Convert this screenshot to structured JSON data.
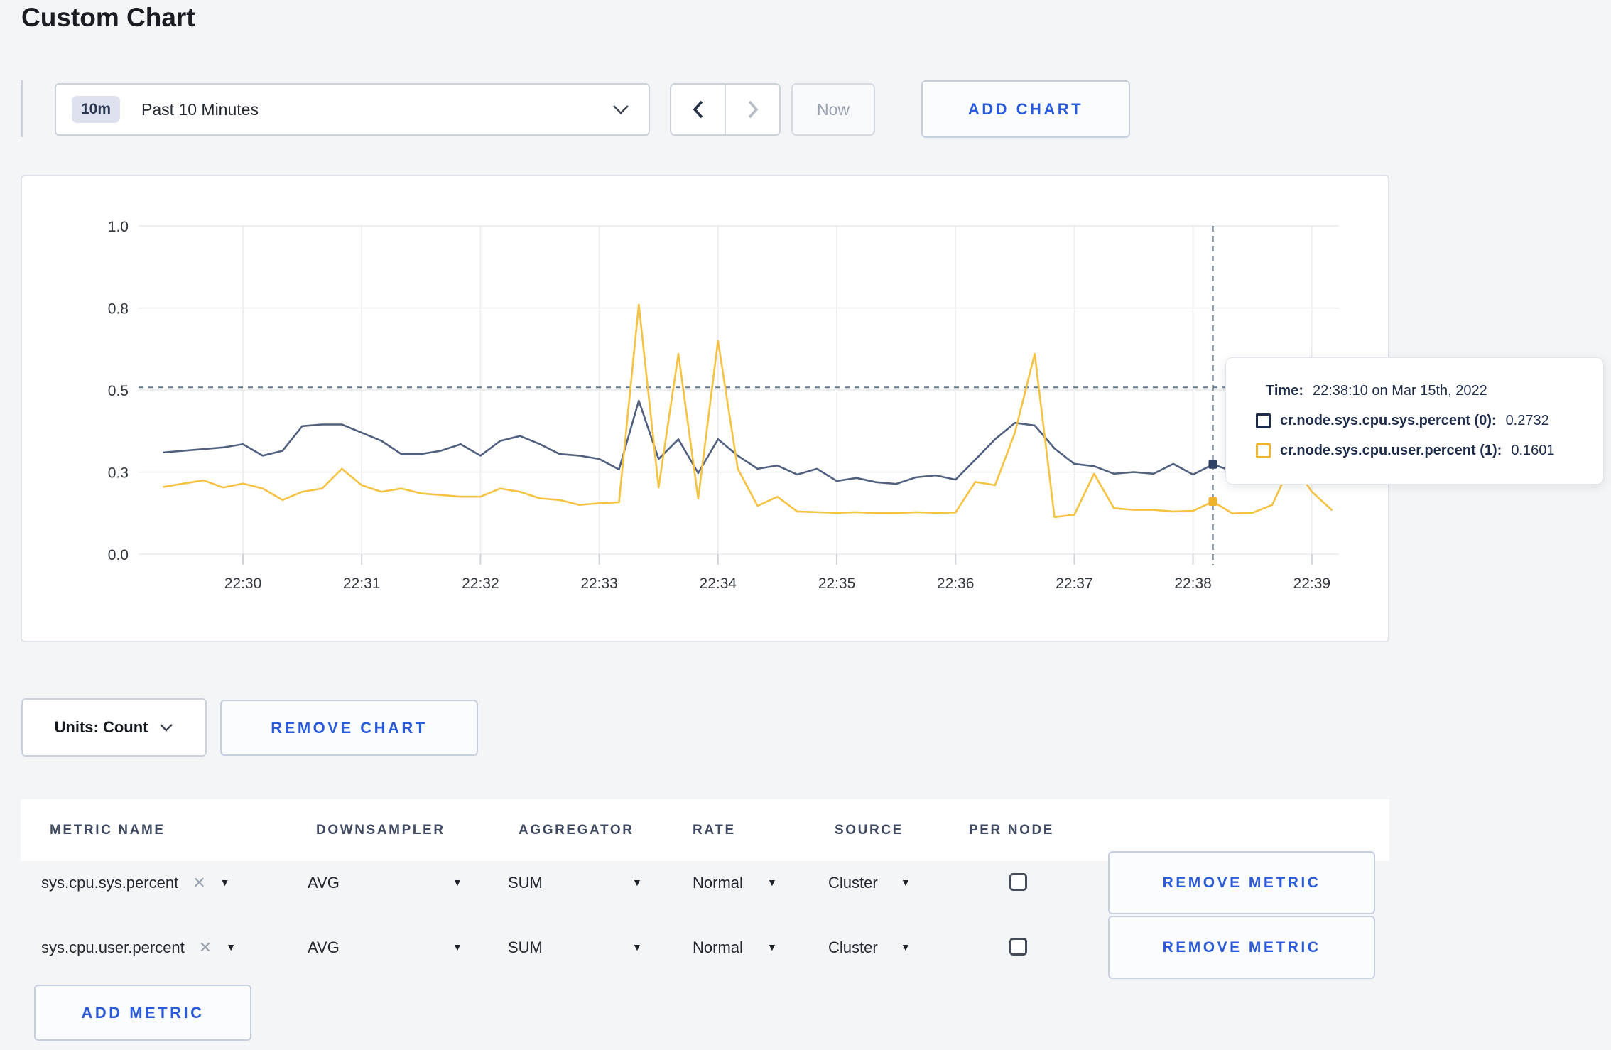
{
  "page": {
    "title": "Custom Chart"
  },
  "toolbar": {
    "time_badge": "10m",
    "time_label": "Past 10 Minutes",
    "now_label": "Now",
    "add_chart_label": "ADD CHART"
  },
  "chart_footer": {
    "units_label": "Units: Count",
    "remove_chart_label": "REMOVE CHART"
  },
  "tooltip": {
    "time_label": "Time:",
    "time_value": "22:38:10 on Mar 15th, 2022",
    "rows": [
      {
        "name": "cr.node.sys.cpu.sys.percent (0):",
        "value": "0.2732",
        "color": "#1c2b4a"
      },
      {
        "name": "cr.node.sys.cpu.user.percent (1):",
        "value": "0.1601",
        "color": "#f0b429"
      }
    ]
  },
  "metrics_table": {
    "headers": [
      "METRIC NAME",
      "DOWNSAMPLER",
      "AGGREGATOR",
      "RATE",
      "SOURCE",
      "PER NODE"
    ],
    "rows": [
      {
        "metric": "sys.cpu.sys.percent",
        "downsampler": "AVG",
        "aggregator": "SUM",
        "rate": "Normal",
        "source": "Cluster",
        "per_node_checked": false,
        "remove_label": "REMOVE METRIC"
      },
      {
        "metric": "sys.cpu.user.percent",
        "downsampler": "AVG",
        "aggregator": "SUM",
        "rate": "Normal",
        "source": "Cluster",
        "per_node_checked": false,
        "remove_label": "REMOVE METRIC"
      }
    ],
    "add_metric_label": "ADD METRIC"
  },
  "chart_data": {
    "type": "line",
    "title": "",
    "xlabel": "",
    "ylabel": "",
    "ylim": [
      0,
      1
    ],
    "grid": true,
    "legend_position": "tooltip",
    "y_ticks": [
      {
        "v": 0,
        "label": "0.0"
      },
      {
        "v": 0.25,
        "label": "0.3"
      },
      {
        "v": 0.5,
        "label": "0.5"
      },
      {
        "v": 0.75,
        "label": "0.8"
      },
      {
        "v": 1,
        "label": "1.0"
      }
    ],
    "x_ticks": [
      {
        "t": 60,
        "label": "22:30"
      },
      {
        "t": 120,
        "label": "22:31"
      },
      {
        "t": 180,
        "label": "22:32"
      },
      {
        "t": 240,
        "label": "22:33"
      },
      {
        "t": 300,
        "label": "22:34"
      },
      {
        "t": 360,
        "label": "22:35"
      },
      {
        "t": 420,
        "label": "22:36"
      },
      {
        "t": 480,
        "label": "22:37"
      },
      {
        "t": 540,
        "label": "22:38"
      },
      {
        "t": 600,
        "label": "22:39"
      }
    ],
    "sample_interval_seconds": 10,
    "series_start_offset_seconds": 20,
    "hover_line_value": 0.508,
    "hover": {
      "t": 550,
      "time": "22:38:10",
      "points": [
        0.2732,
        0.1601
      ]
    },
    "series": [
      {
        "name": "cr.node.sys.cpu.sys.percent",
        "color": "#51607F",
        "dot_color": "#2F4164",
        "values": [
          0.31,
          0.315,
          0.32,
          0.325,
          0.335,
          0.3,
          0.315,
          0.39,
          0.395,
          0.395,
          0.37,
          0.345,
          0.305,
          0.305,
          0.315,
          0.335,
          0.3,
          0.345,
          0.36,
          0.335,
          0.305,
          0.3,
          0.29,
          0.258,
          0.4675,
          0.29,
          0.35,
          0.247,
          0.35,
          0.3,
          0.26,
          0.27,
          0.2425,
          0.26,
          0.223,
          0.232,
          0.219,
          0.214,
          0.234,
          0.24,
          0.227,
          0.288,
          0.35,
          0.4,
          0.392,
          0.322,
          0.275,
          0.268,
          0.245,
          0.25,
          0.245,
          0.275,
          0.2425,
          0.2732,
          0.253,
          0.26,
          0.27,
          0.26,
          0.27,
          0.26
        ]
      },
      {
        "name": "cr.node.sys.cpu.user.percent",
        "color": "#F5C242",
        "dot_color": "#EFB32A",
        "values": [
          0.205,
          0.215,
          0.225,
          0.203,
          0.215,
          0.2,
          0.165,
          0.19,
          0.2,
          0.26,
          0.21,
          0.19,
          0.2,
          0.185,
          0.18,
          0.175,
          0.175,
          0.2,
          0.19,
          0.17,
          0.165,
          0.15,
          0.155,
          0.158,
          0.76,
          0.203,
          0.61,
          0.169,
          0.65,
          0.26,
          0.147,
          0.175,
          0.13,
          0.128,
          0.126,
          0.128,
          0.125,
          0.125,
          0.128,
          0.126,
          0.127,
          0.22,
          0.21,
          0.37,
          0.61,
          0.113,
          0.12,
          0.245,
          0.14,
          0.135,
          0.135,
          0.13,
          0.132,
          0.1601,
          0.124,
          0.126,
          0.15,
          0.28,
          0.19,
          0.135
        ]
      }
    ]
  }
}
